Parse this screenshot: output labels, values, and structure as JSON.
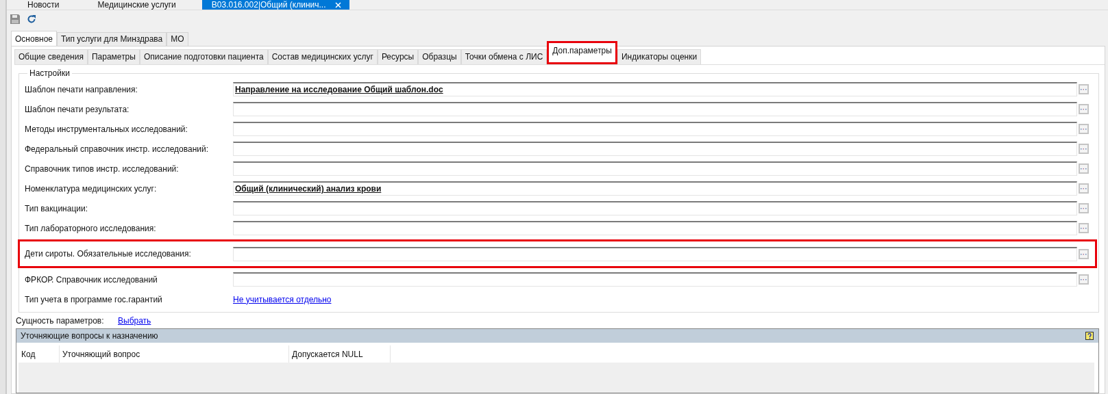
{
  "doc_tabs": [
    {
      "label": "Новости",
      "selected": false,
      "closable": false
    },
    {
      "label": "Медицинские услуги",
      "selected": false,
      "closable": false
    },
    {
      "label": "B03.016.002|Общий (клинич...",
      "selected": true,
      "closable": true
    }
  ],
  "main_tabs": [
    {
      "label": "Основное",
      "selected": true
    },
    {
      "label": "Тип услуги для Минздрава",
      "selected": false
    },
    {
      "label": "МО",
      "selected": false
    }
  ],
  "sub_tabs": [
    {
      "label": "Общие сведения",
      "selected": false,
      "highlighted": false
    },
    {
      "label": "Параметры",
      "selected": false,
      "highlighted": false
    },
    {
      "label": "Описание подготовки пациента",
      "selected": false,
      "highlighted": false
    },
    {
      "label": "Состав медицинских услуг",
      "selected": false,
      "highlighted": false
    },
    {
      "label": "Ресурсы",
      "selected": false,
      "highlighted": false
    },
    {
      "label": "Образцы",
      "selected": false,
      "highlighted": false
    },
    {
      "label": "Точки обмена с ЛИС",
      "selected": false,
      "highlighted": false
    },
    {
      "label": "Доп.параметры",
      "selected": true,
      "highlighted": true
    },
    {
      "label": "Индикаторы оценки",
      "selected": false,
      "highlighted": false
    }
  ],
  "settings": {
    "title": "Настройки",
    "rows": [
      {
        "kind": "reference",
        "label": "Шаблон печати направления:",
        "value": "Направление на исследование  Общий шаблон.doc",
        "highlighted": false
      },
      {
        "kind": "reference",
        "label": "Шаблон печати результата:",
        "highlighted": false
      },
      {
        "kind": "reference",
        "label": "Методы инструментальных исследований:",
        "highlighted": false
      },
      {
        "kind": "reference",
        "label": "Федеральный справочник инстр. исследований:",
        "highlighted": false
      },
      {
        "kind": "reference",
        "label": "Справочник типов инстр. исследований:",
        "highlighted": false
      },
      {
        "kind": "reference",
        "label": "Номенклатура медицинских услуг:",
        "value": "Общий (клинический) анализ крови",
        "highlighted": false
      },
      {
        "kind": "reference",
        "label": "Тип вакцинации:",
        "highlighted": false
      },
      {
        "kind": "reference",
        "label": "Тип лабораторного исследования:",
        "highlighted": false
      },
      {
        "kind": "reference",
        "label": "Дети сироты. Обязательные исследования:",
        "highlighted": true
      },
      {
        "kind": "reference",
        "label": "ФРКОР. Справочник исследований",
        "highlighted": false
      },
      {
        "kind": "link",
        "label": "Тип учета в программе гос.гарантий",
        "value": "Не учитывается отдельно",
        "highlighted": false
      }
    ]
  },
  "entity": {
    "label": "Сущность параметров:",
    "link": "Выбрать"
  },
  "questions": {
    "title": "Уточняющие вопросы к назначению",
    "columns": [
      "Код",
      "Уточняющий вопрос",
      "Допускается NULL"
    ]
  }
}
